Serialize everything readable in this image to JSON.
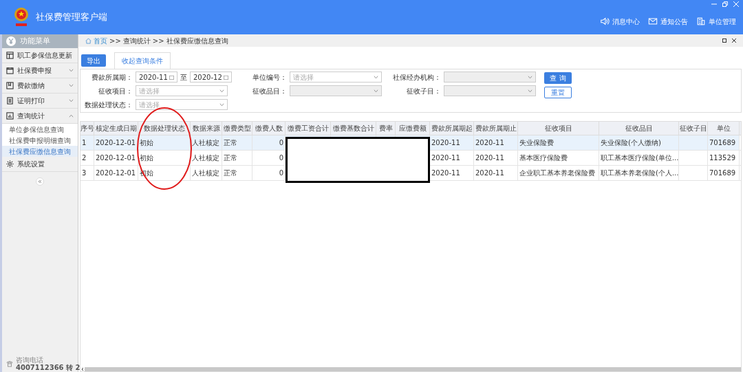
{
  "header": {
    "title": "社保费管理客户端",
    "nav": [
      {
        "label": "消息中心",
        "kind": "speaker"
      },
      {
        "label": "通知公告",
        "kind": "mail"
      },
      {
        "label": "单位管理",
        "kind": "building"
      }
    ]
  },
  "sidebar": {
    "title": "功能菜单",
    "items": [
      {
        "label": "职工参保信息更新",
        "kind": "table"
      },
      {
        "label": "社保费申报",
        "kind": "calendar",
        "expanded": false
      },
      {
        "label": "费款缴纳",
        "kind": "bookmark",
        "expanded": false
      },
      {
        "label": "证明打印",
        "kind": "doc",
        "expanded": false
      },
      {
        "label": "查询统计",
        "kind": "chart",
        "expanded": true,
        "children": [
          {
            "label": "单位参保信息查询",
            "selected": false
          },
          {
            "label": "社保费申报明细查询",
            "selected": false
          },
          {
            "label": "社保费应缴信息查询",
            "selected": true
          }
        ]
      },
      {
        "label": "系统设置",
        "kind": "gear"
      }
    ],
    "contact": {
      "label": "咨询电话",
      "phone": "4007112366 转 2"
    }
  },
  "breadcrumb": [
    {
      "text": "首页",
      "kind": "link"
    },
    {
      "text": ">>",
      "kind": "sep"
    },
    {
      "text": "查询统计",
      "kind": "text"
    },
    {
      "text": ">>",
      "kind": "sep"
    },
    {
      "text": "社保费应缴信息查询",
      "kind": "text"
    }
  ],
  "toolbar": {
    "export": "导出",
    "tabs": [
      {
        "label": "收起查询条件",
        "selected": true
      }
    ]
  },
  "form": {
    "rows": [
      [
        {
          "kind": "daterange",
          "label": "费款所属期：",
          "from": "2020-11",
          "sep": "至",
          "to": "2020-12"
        },
        {
          "kind": "select",
          "label": "单位编号：",
          "placeholder": "请选择",
          "disabled": false
        },
        {
          "kind": "select",
          "label": "社保经办机构：",
          "disabled": true
        }
      ],
      [
        {
          "kind": "select",
          "label": "征收项目：",
          "placeholder": "请选择",
          "disabled": false
        },
        {
          "kind": "select",
          "label": "征收品目：",
          "disabled": true
        },
        {
          "kind": "select",
          "label": "征收子目：",
          "disabled": true
        }
      ],
      [
        {
          "kind": "select",
          "label": "数据处理状态：",
          "placeholder": "请选择",
          "disabled": false
        }
      ]
    ],
    "buttons": [
      {
        "label": "查 询",
        "kind": "primary"
      },
      {
        "label": "重置",
        "kind": "secondary"
      }
    ]
  },
  "table": {
    "columns": [
      "序号",
      "核定生成日期",
      "数据处理状态",
      "数据来源",
      "缴费类型",
      "缴费人数",
      "缴费工资合计",
      "缴费基数合计",
      "费率",
      "应缴费额",
      "费款所属期起",
      "费款所属期止",
      "征收项目",
      "征收品目",
      "征收子目",
      "单位"
    ],
    "rows": [
      {
        "selected": true,
        "cells": [
          "1",
          "2020-12-01",
          "初始",
          "人社核定",
          "正常",
          "0",
          null,
          null,
          null,
          null,
          "2020-11",
          "2020-11",
          "失业保险费",
          "失业保险(个人缴纳)",
          null,
          "701689"
        ]
      },
      {
        "selected": false,
        "cells": [
          "2",
          "2020-12-01",
          "初始",
          "人社核定",
          "正常",
          "0",
          null,
          null,
          null,
          null,
          "2020-11",
          "2020-11",
          "基本医疗保险费",
          "职工基本医疗保险(单位...",
          null,
          "113529"
        ]
      },
      {
        "selected": false,
        "cells": [
          "3",
          "2020-12-01",
          "初始",
          "人社核定",
          "正常",
          "0",
          null,
          null,
          null,
          null,
          "2020-11",
          "2020-11",
          "企业职工基本养老保险费",
          "职工基本养老保险(个人...",
          null,
          "701689"
        ]
      }
    ]
  }
}
